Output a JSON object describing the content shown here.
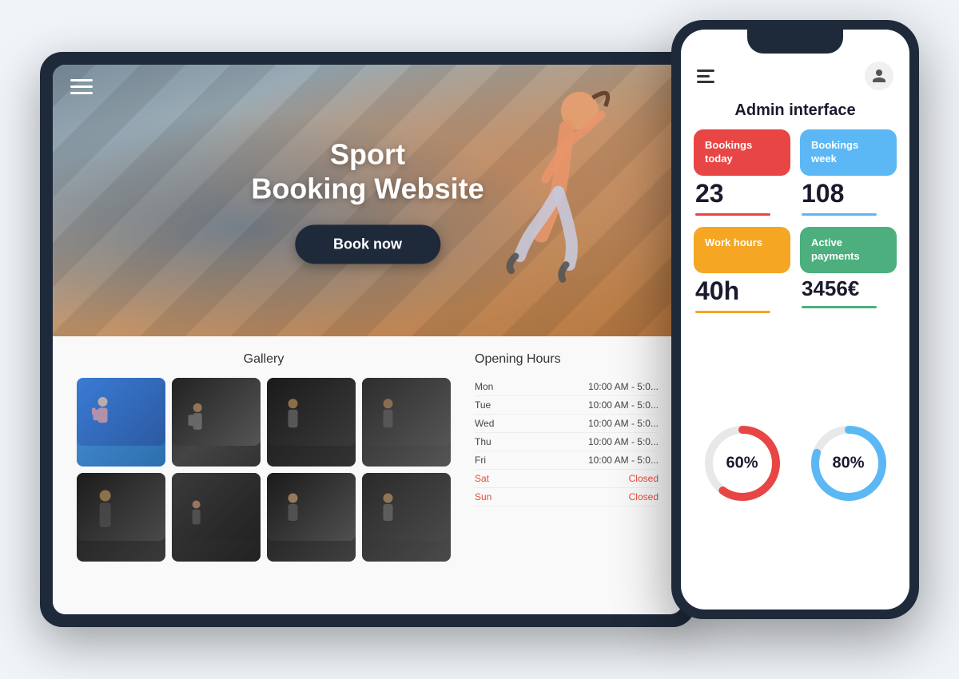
{
  "scene": {
    "tablet": {
      "hero": {
        "menu_icon_label": "menu",
        "title_line1": "Sport",
        "title_line2": "Booking Website",
        "book_button": "Book now"
      },
      "gallery": {
        "title": "Gallery",
        "items": [
          {
            "id": 1,
            "alt": "gym photo 1"
          },
          {
            "id": 2,
            "alt": "gym photo 2"
          },
          {
            "id": 3,
            "alt": "gym photo 3"
          },
          {
            "id": 4,
            "alt": "gym photo 4"
          },
          {
            "id": 5,
            "alt": "gym photo 5"
          },
          {
            "id": 6,
            "alt": "gym photo 6"
          },
          {
            "id": 7,
            "alt": "gym photo 7"
          },
          {
            "id": 8,
            "alt": "gym photo 8"
          }
        ]
      },
      "opening_hours": {
        "title": "Opening Hours",
        "rows": [
          {
            "day": "Mon",
            "hours": "10:00 AM - 5:0...",
            "closed": false
          },
          {
            "day": "Tue",
            "hours": "10:00 AM - 5:0...",
            "closed": false
          },
          {
            "day": "Wed",
            "hours": "10:00 AM - 5:0...",
            "closed": false
          },
          {
            "day": "Thu",
            "hours": "10:00 AM - 5:0...",
            "closed": false
          },
          {
            "day": "Fri",
            "hours": "10:00 AM - 5:0...",
            "closed": false
          },
          {
            "day": "Sat",
            "hours": "Closed",
            "closed": true
          },
          {
            "day": "Sun",
            "hours": "Closed",
            "closed": true
          }
        ]
      }
    },
    "phone": {
      "header": {
        "user_icon_label": "user"
      },
      "admin": {
        "title": "Admin interface",
        "stats": [
          {
            "label": "Bookings today",
            "color": "red",
            "value": "23"
          },
          {
            "label": "Bookings week",
            "color": "blue",
            "value": "108"
          },
          {
            "label": "Work hours",
            "color": "yellow",
            "value": "40h"
          },
          {
            "label": "Active payments",
            "color": "green",
            "value": "3456€"
          }
        ],
        "charts": [
          {
            "label": "60%",
            "percent": 60,
            "color": "#e84545"
          },
          {
            "label": "80%",
            "percent": 80,
            "color": "#5bb8f5"
          }
        ]
      }
    }
  }
}
